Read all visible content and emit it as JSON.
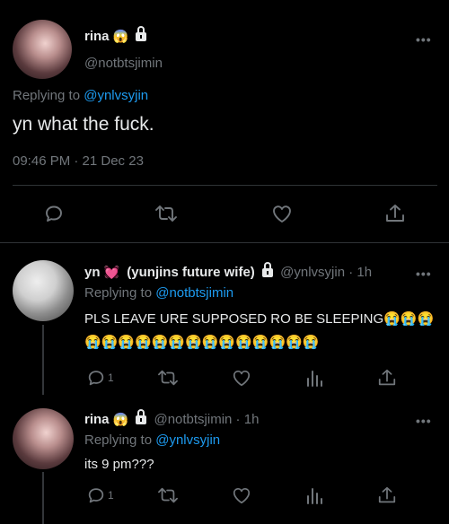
{
  "main_tweet": {
    "display_name": "rina",
    "name_emoji": "😱",
    "handle": "@notbtsjimin",
    "replying_prefix": "Replying to",
    "replying_to": "@ynlvsyjin",
    "text": "yn what the fuck.",
    "timestamp": "09:46 PM · 21 Dec 23"
  },
  "replies": [
    {
      "display_name": "yn",
      "name_emoji": "💓",
      "nickname": "(yunjins future wife)",
      "handle_time": "@ynlvsyjin · 1h",
      "replying_prefix": "Replying to",
      "replying_to": "@notbtsjimin",
      "text_line1": "PLS LEAVE URE SUPPOSED RO BE SLEEPING😭😭😭",
      "text_line2": "😭😭😭😭😭😭😭😭😭😭😭😭😭😭",
      "reply_count": "1"
    },
    {
      "display_name": "rina",
      "name_emoji": "😱",
      "handle_time": "@notbtsjimin · 1h",
      "replying_prefix": "Replying to",
      "replying_to": "@ynlvsyjin",
      "text": "its 9 pm???",
      "reply_count": "1"
    }
  ],
  "more_label": "•••",
  "colors": {
    "link": "#1d9bf0",
    "muted": "#71767b",
    "text": "#e7e9ea",
    "background": "#000000"
  }
}
